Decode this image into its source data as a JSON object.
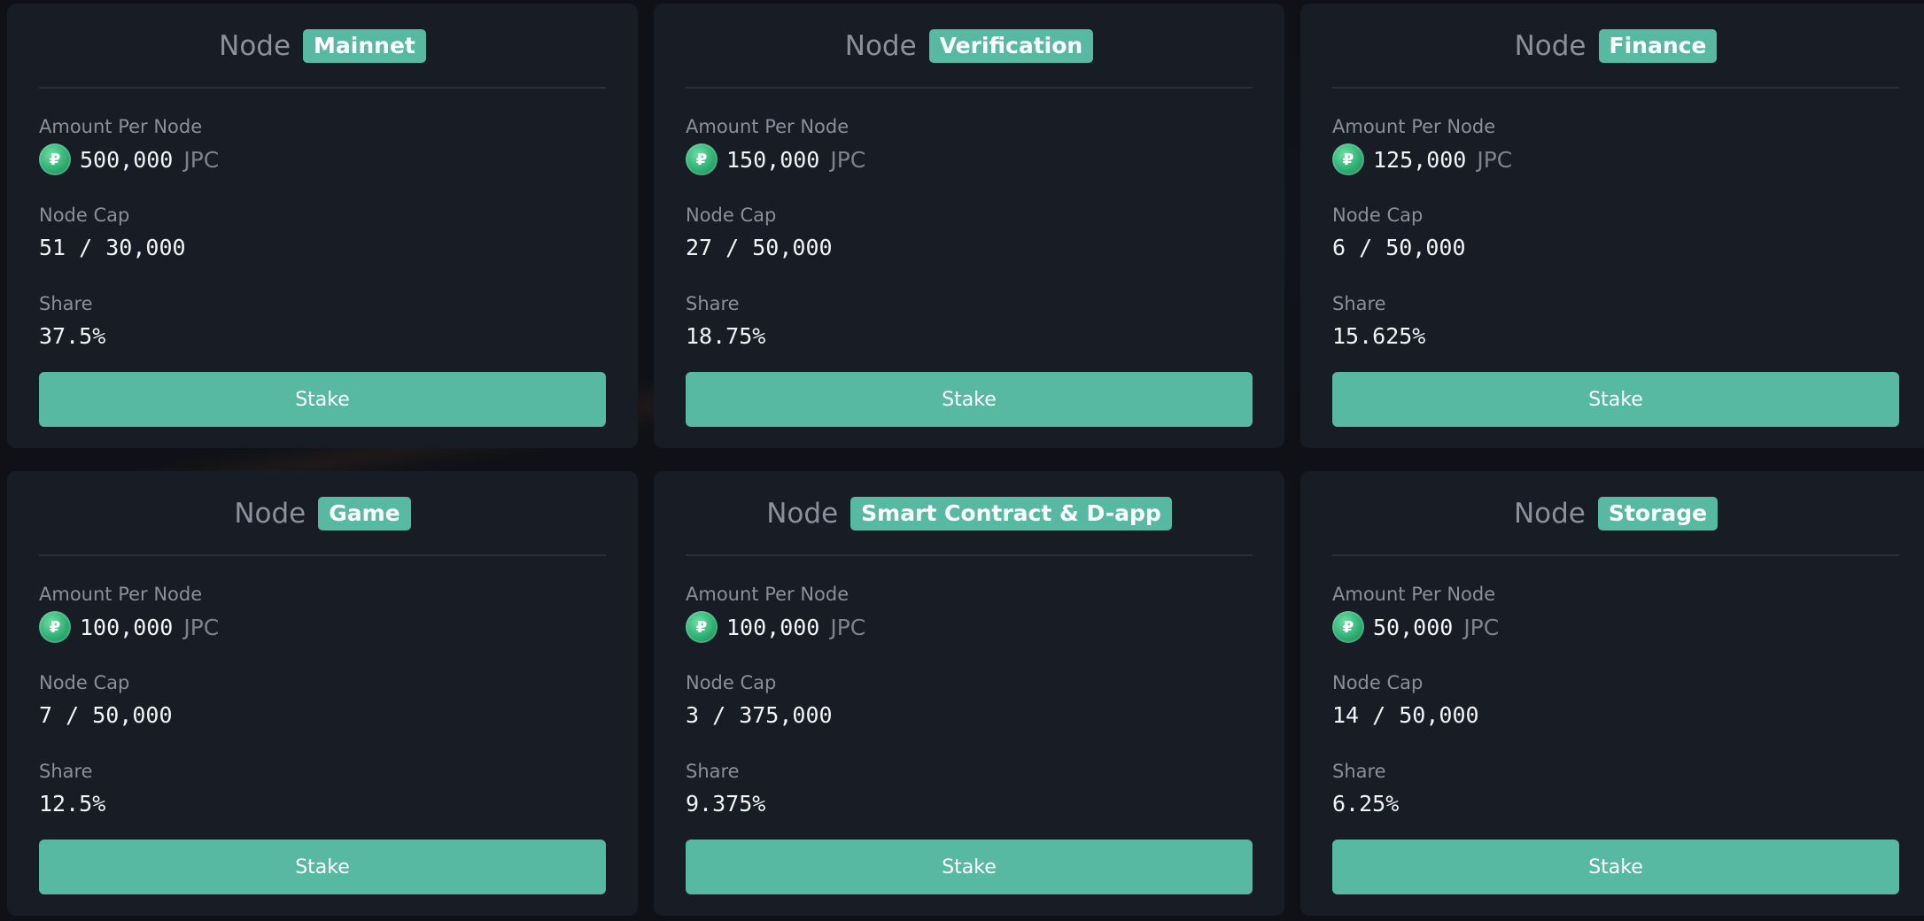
{
  "colors": {
    "accent": "#58b9a2",
    "card_bg": "#181c24",
    "page_bg": "#0f1116"
  },
  "labels": {
    "node_word": "Node",
    "amount_label": "Amount Per Node",
    "cap_label": "Node Cap",
    "share_label": "Share",
    "unit": "JPC",
    "coin_icon": "jpc-coin-icon",
    "stake_button": "Stake"
  },
  "nodes": [
    {
      "type": "Mainnet",
      "amount": "500,000",
      "cap": "51 / 30,000",
      "share": "37.5%"
    },
    {
      "type": "Verification",
      "amount": "150,000",
      "cap": "27 / 50,000",
      "share": "18.75%"
    },
    {
      "type": "Finance",
      "amount": "125,000",
      "cap": "6 / 50,000",
      "share": "15.625%"
    },
    {
      "type": "Game",
      "amount": "100,000",
      "cap": "7 / 50,000",
      "share": "12.5%"
    },
    {
      "type": "Smart Contract & D-app",
      "amount": "100,000",
      "cap": "3 / 375,000",
      "share": "9.375%"
    },
    {
      "type": "Storage",
      "amount": "50,000",
      "cap": "14 / 50,000",
      "share": "6.25%"
    }
  ]
}
